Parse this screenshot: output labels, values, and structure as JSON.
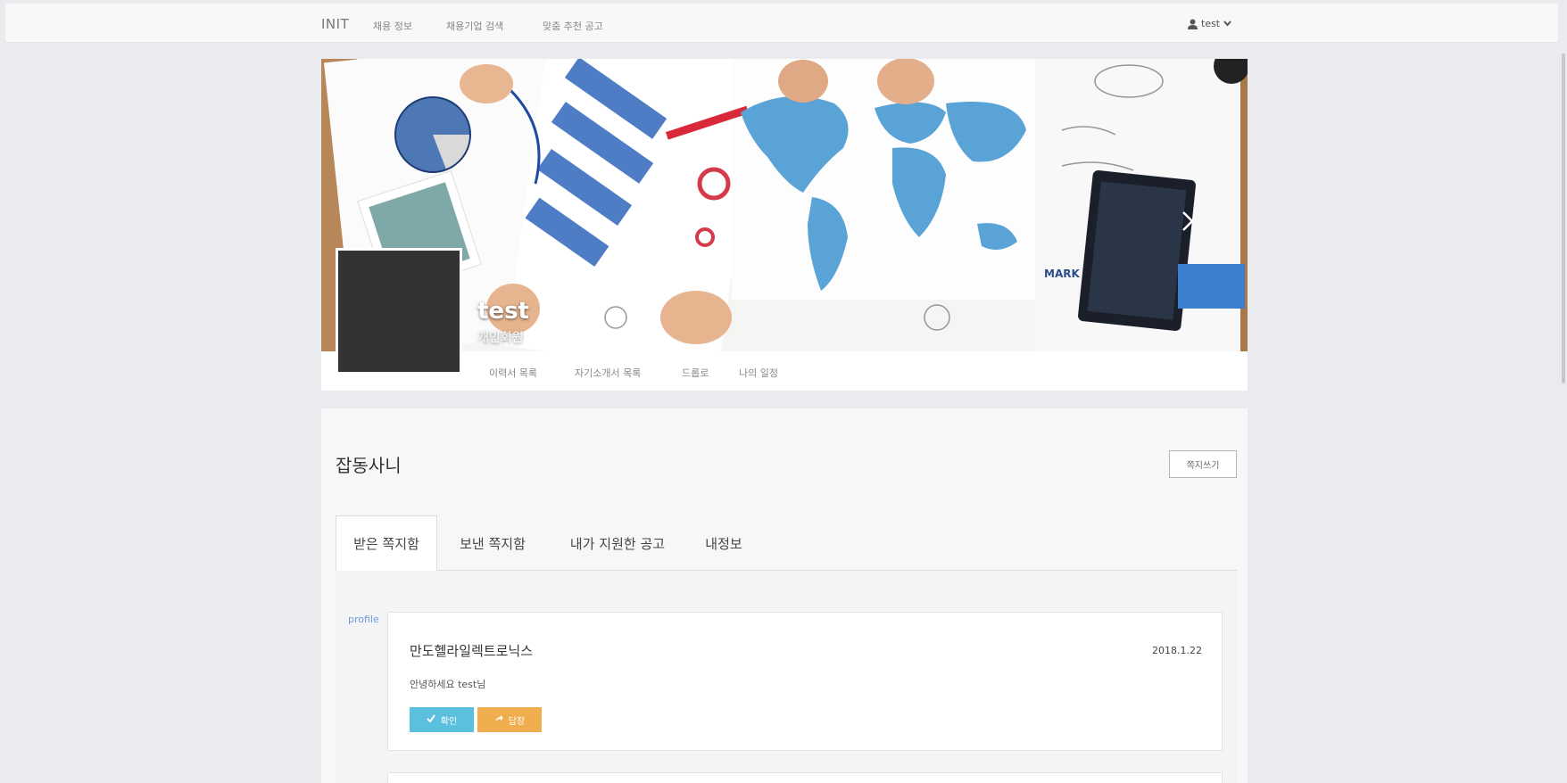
{
  "navbar": {
    "brand": "INIT",
    "links": [
      "채용 정보",
      "채용기업 검색",
      "맞춤 추천 공고"
    ],
    "user": "test"
  },
  "profile": {
    "name": "test",
    "type": "개인회원",
    "tabs": [
      "이력서 목록",
      "자기소개서 목록",
      "드롭로",
      "나의 일정"
    ]
  },
  "panel": {
    "title": "잡동사니",
    "write_button": "쪽지쓰기",
    "tabs": [
      "받은 쪽지함",
      "보낸 쪽지함",
      "내가 지원한 공고",
      "내정보"
    ]
  },
  "message": {
    "profile_link": "profile",
    "sender": "만도헬라일렉트로닉스",
    "date": "2018.1.22",
    "body": "안녕하세요 test님",
    "confirm_label": "확인",
    "reply_label": "답장"
  },
  "colors": {
    "confirm": "#5bc0de",
    "reply": "#f0ad4e",
    "map": "#5aa3d6",
    "avatar": "#333333"
  },
  "icons": [
    "user-icon",
    "chevron-down-icon",
    "chevron-right-icon",
    "check-icon",
    "share-icon"
  ]
}
